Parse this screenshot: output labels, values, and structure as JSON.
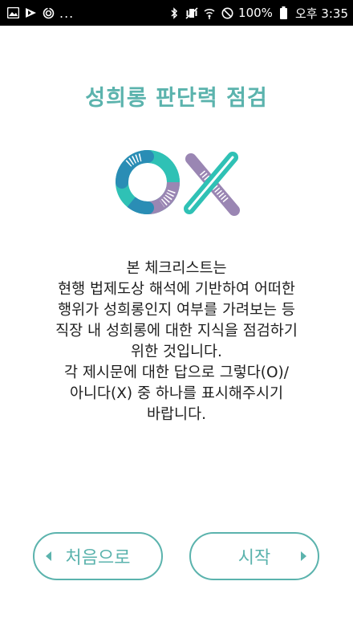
{
  "status_bar": {
    "more": "...",
    "battery_percent": "100%",
    "clock": "오후 3:35",
    "left_icons": [
      "gallery-icon",
      "video-icon",
      "sync-icon"
    ],
    "right_icons": [
      "bluetooth-icon",
      "vibrate-mute-icon",
      "wifi-icon",
      "do-not-disturb-icon",
      "battery-icon"
    ]
  },
  "page": {
    "title": "성희롱 판단력 점검",
    "logo": "OX",
    "description_lines": [
      "본 체크리스트는",
      "현행 법제도상 해석에 기반하여 어떠한",
      "행위가 성희롱인지 여부를 가려보는 등",
      "직장 내 성희롱에 대한 지식을 점검하기",
      "위한 것입니다.",
      "각 제시문에 대한 답으로 그렇다(O)/",
      "아니다(X) 중 하나를 표시해주시기",
      "바랍니다."
    ]
  },
  "buttons": {
    "home_label": "처음으로",
    "start_label": "시작"
  },
  "colors": {
    "accent": "#5bb3ad",
    "logo_teal": "#2fc1b5",
    "logo_blue": "#2a8db5",
    "logo_purple": "#9a86b3"
  }
}
